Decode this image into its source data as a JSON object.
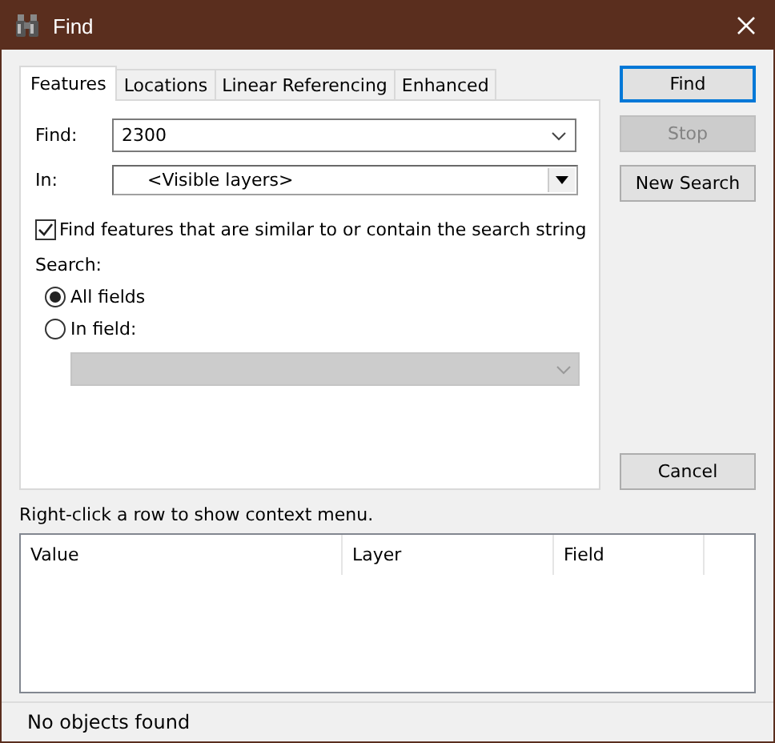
{
  "window": {
    "title": "Find"
  },
  "tabs": [
    {
      "label": "Features",
      "selected": true
    },
    {
      "label": "Locations",
      "selected": false
    },
    {
      "label": "Linear Referencing",
      "selected": false
    },
    {
      "label": "Enhanced",
      "selected": false
    }
  ],
  "find": {
    "label": "Find:",
    "value": "2300"
  },
  "in": {
    "label": "In:",
    "value": "<Visible layers>"
  },
  "similar": {
    "label": "Find features that are similar to or contain the search string",
    "checked": true
  },
  "search": {
    "label": "Search:",
    "options": [
      {
        "label": "All fields",
        "selected": true
      },
      {
        "label": "In field:",
        "selected": false
      }
    ]
  },
  "field_combo": {
    "disabled": true
  },
  "buttons": [
    {
      "label": "Find",
      "default": true,
      "disabled": false
    },
    {
      "label": "Stop",
      "default": false,
      "disabled": true
    },
    {
      "label": "New Search",
      "default": false,
      "disabled": false
    }
  ],
  "cancel": {
    "label": "Cancel"
  },
  "hint": "Right-click a row to show context menu.",
  "table": {
    "columns": [
      "Value",
      "Layer",
      "Field"
    ]
  },
  "status_bar": "No objects found"
}
